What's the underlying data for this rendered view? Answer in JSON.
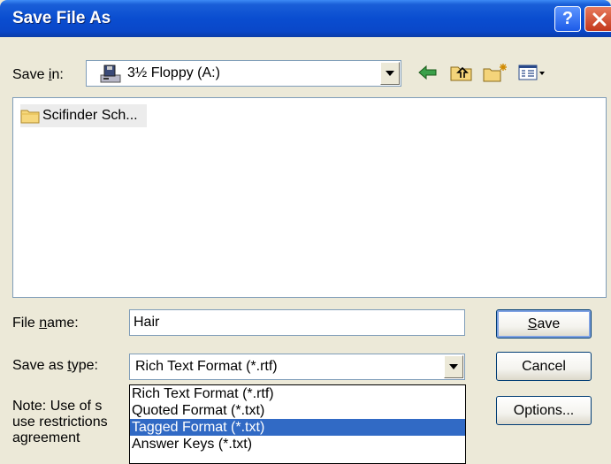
{
  "window": {
    "title": "Save File As"
  },
  "save_in": {
    "label_pre": "Save ",
    "label_hot": "i",
    "label_post": "n:",
    "value": "3½ Floppy (A:)"
  },
  "toolbar": {
    "icons": [
      "back-arrow-icon",
      "up-folder-icon",
      "new-folder-icon",
      "view-menu-icon"
    ]
  },
  "files": [
    {
      "name": "Scifinder Sch...",
      "icon": "folder-icon"
    }
  ],
  "file_name": {
    "label_pre": "File ",
    "label_hot": "n",
    "label_post": "ame:",
    "value": "Hair"
  },
  "save_as_type": {
    "label_pre": "Save as ",
    "label_hot": "t",
    "label_post": "ype:",
    "value": "Rich Text Format (*.rtf)",
    "options": [
      "Rich Text Format (*.rtf)",
      "Quoted Format (*.txt)",
      "Tagged Format (*.txt)",
      "Answer Keys (*.txt)"
    ],
    "selected_index": 2
  },
  "note": {
    "line1": "Note:  Use of s",
    "line2": "use restrictions",
    "line3": "agreement"
  },
  "buttons": {
    "save_hot": "S",
    "save_rest": "ave",
    "cancel": "Cancel",
    "options": "Options..."
  },
  "colors": {
    "titlebar": "#0a4dd0",
    "selection": "#316ac5",
    "dialog_bg": "#ece9d8"
  }
}
